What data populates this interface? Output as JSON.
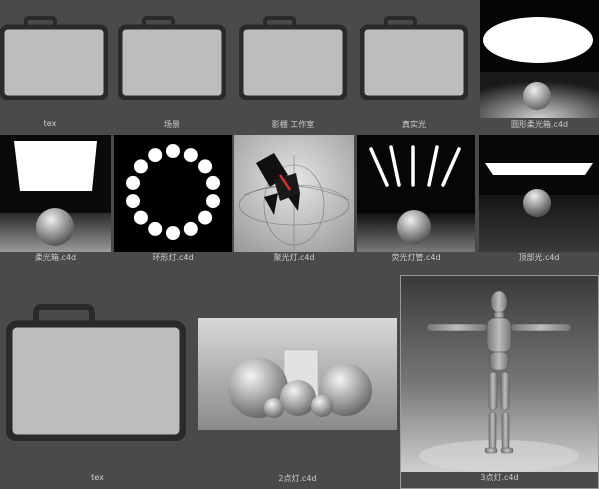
{
  "assets": {
    "tex": "tex",
    "scene": "场景",
    "studio": "影棚 工作室",
    "real_light": "真实光",
    "round_softbox": "圆形柔光箱.c4d",
    "softbox": "柔光箱.c4d",
    "ring_light": "环形灯.c4d",
    "spotlight": "聚光灯.c4d",
    "fluorescent_tubes": "荧光灯管.c4d",
    "top_light": "顶部光.c4d",
    "tex_large": "tex",
    "two_point_lights": "2点灯.c4d",
    "three_point_lights": "3点灯.c4d"
  },
  "icons": {
    "folder": "folder-icon"
  },
  "colors": {
    "background": "#4a4a4a",
    "folder_fill": "#bdbdbd",
    "folder_border": "#2a2a2a",
    "label": "#cfcfcf"
  }
}
